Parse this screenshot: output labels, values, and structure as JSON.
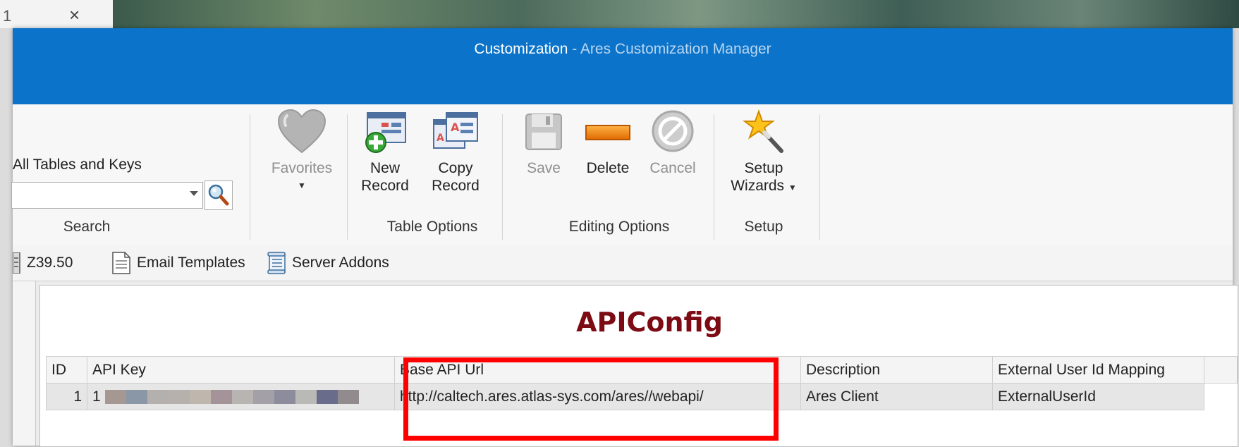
{
  "background": {
    "behind_tab_text": "1",
    "close_glyph": "×"
  },
  "window": {
    "title_main": "Customization",
    "title_separator": " - ",
    "title_sub": "Ares Customization Manager",
    "accent_color": "#0b73c9"
  },
  "ribbon": {
    "search": {
      "caption": "All Tables and Keys",
      "input_value": "",
      "group_label": "Search",
      "button_icon": "magnifier-icon"
    },
    "favorites": {
      "label": "Favorites",
      "icon": "heart-icon"
    },
    "table_options": {
      "group_label": "Table Options",
      "new_record": {
        "line1": "New",
        "line2": "Record",
        "icon": "new-record-icon"
      },
      "copy_record": {
        "line1": "Copy",
        "line2": "Record",
        "icon": "copy-record-icon"
      }
    },
    "editing_options": {
      "group_label": "Editing Options",
      "save": {
        "label": "Save",
        "icon": "floppy-disk-icon"
      },
      "delete": {
        "label": "Delete",
        "icon": "delete-bar-icon"
      },
      "cancel": {
        "label": "Cancel",
        "icon": "cancel-icon"
      }
    },
    "setup": {
      "group_label": "Setup",
      "wizards": {
        "line1": "Setup",
        "line2": "Wizards",
        "icon": "magic-wand-icon"
      }
    }
  },
  "tabs": [
    {
      "label": "Z39.50",
      "icon": "server-icon"
    },
    {
      "label": "Email Templates",
      "icon": "document-icon"
    },
    {
      "label": "Server Addons",
      "icon": "scroll-icon"
    }
  ],
  "grid": {
    "title": "APIConfig",
    "title_color": "#7c0b14",
    "columns": [
      "ID",
      "API Key",
      "Base API Url",
      "Description",
      "External User Id Mapping"
    ],
    "rows": [
      {
        "id": "1",
        "api_key_visible": "1",
        "base_api_url": "http://caltech.ares.atlas-sys.com/ares//webapi/",
        "description": "Ares Client",
        "external_user_id_mapping": "ExternalUserId"
      }
    ]
  },
  "annotation": {
    "highlight_color": "#ff0000"
  }
}
